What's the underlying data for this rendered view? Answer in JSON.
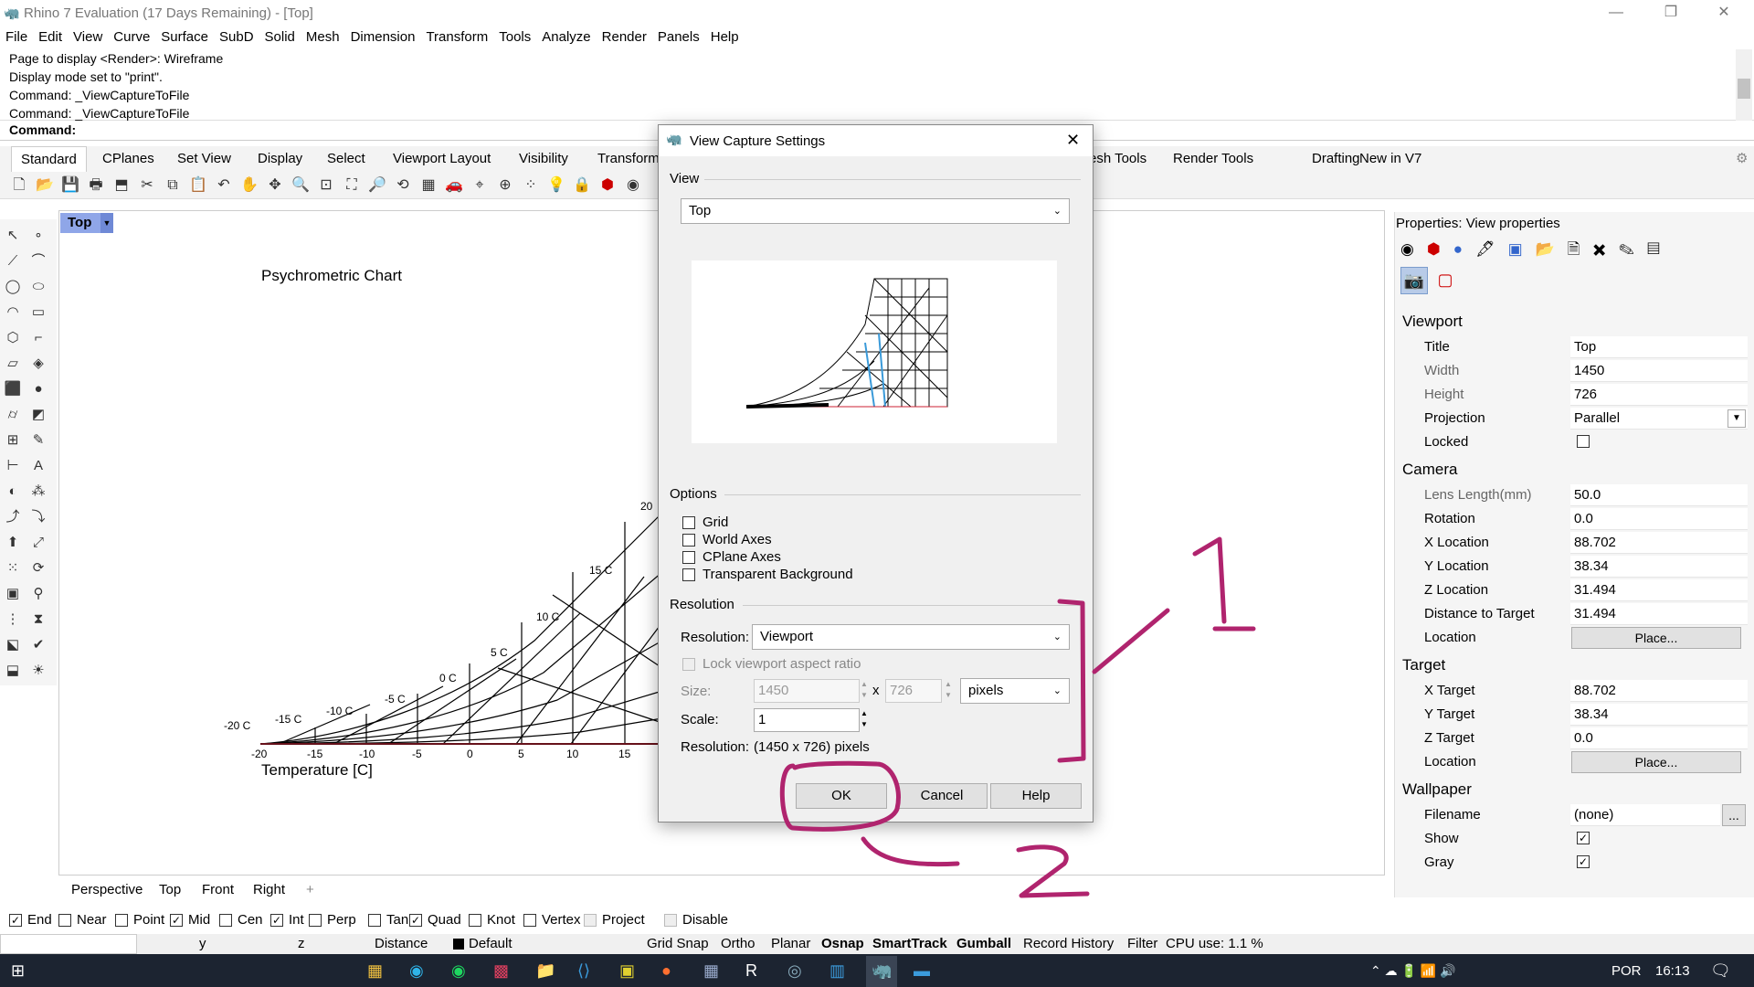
{
  "window": {
    "title": "Rhino 7 Evaluation (17 Days Remaining) - [Top]"
  },
  "menu": [
    "File",
    "Edit",
    "View",
    "Curve",
    "Surface",
    "SubD",
    "Solid",
    "Mesh",
    "Dimension",
    "Transform",
    "Tools",
    "Analyze",
    "Render",
    "Panels",
    "Help"
  ],
  "history": [
    "Page to display <Render>: Wireframe",
    "Display mode set to \"print\".",
    "Command: _ViewCaptureToFile",
    "Command: _ViewCaptureToFile"
  ],
  "command_label": "Command:",
  "toolbar_tabs": [
    "Standard",
    "CPlanes",
    "Set View",
    "Display",
    "Select",
    "Viewport Layout",
    "Visibility",
    "Transform"
  ],
  "toolbar_tabs_right": [
    "esh Tools",
    "Render Tools",
    "Drafting",
    "New in V7"
  ],
  "viewport": {
    "label": "Top",
    "chart_title": "Psychrometric Chart",
    "x_axis_label": "Temperature [C]",
    "x_ticks": [
      "-20",
      "-15",
      "-10",
      "-5",
      "0",
      "5",
      "10",
      "15"
    ],
    "curve_labels": [
      "-20 C",
      "-15 C",
      "-10 C",
      "-5 C",
      "0 C",
      "5 C",
      "10 C",
      "15 C",
      "20"
    ]
  },
  "viewport_tabs": [
    "Perspective",
    "Top",
    "Front",
    "Right"
  ],
  "osnap": [
    {
      "label": "End",
      "checked": true
    },
    {
      "label": "Near",
      "checked": false
    },
    {
      "label": "Point",
      "checked": false
    },
    {
      "label": "Mid",
      "checked": true
    },
    {
      "label": "Cen",
      "checked": false
    },
    {
      "label": "Int",
      "checked": true
    },
    {
      "label": "Perp",
      "checked": false
    },
    {
      "label": "Tan",
      "checked": false
    },
    {
      "label": "Quad",
      "checked": true
    },
    {
      "label": "Knot",
      "checked": false
    },
    {
      "label": "Vertex",
      "checked": false
    },
    {
      "label": "Project",
      "checked": false
    },
    {
      "label": "Disable",
      "checked": false
    }
  ],
  "status": {
    "y": "y",
    "z": "z",
    "distance": "Distance",
    "layer": "Default",
    "grid_snap": "Grid Snap",
    "ortho": "Ortho",
    "planar": "Planar",
    "osnap": "Osnap",
    "smarttrack": "SmartTrack",
    "gumball": "Gumball",
    "record_history": "Record History",
    "filter": "Filter",
    "cpu": "CPU use: 1.1 %"
  },
  "properties": {
    "header": "Properties: View properties",
    "viewport_section": "Viewport",
    "camera_section": "Camera",
    "target_section": "Target",
    "wallpaper_section": "Wallpaper",
    "viewport": {
      "title_label": "Title",
      "title": "Top",
      "width_label": "Width",
      "width": "1450",
      "height_label": "Height",
      "height": "726",
      "projection_label": "Projection",
      "projection": "Parallel",
      "locked_label": "Locked"
    },
    "camera": {
      "lens_label": "Lens Length(mm)",
      "lens": "50.0",
      "rotation_label": "Rotation",
      "rotation": "0.0",
      "xloc_label": "X Location",
      "xloc": "88.702",
      "yloc_label": "Y Location",
      "yloc": "38.34",
      "zloc_label": "Z Location",
      "zloc": "31.494",
      "dist_label": "Distance to Target",
      "dist": "31.494",
      "loc_label": "Location",
      "place": "Place..."
    },
    "target": {
      "x_label": "X Target",
      "x": "88.702",
      "y_label": "Y Target",
      "y": "38.34",
      "z_label": "Z Target",
      "z": "0.0",
      "loc_label": "Location",
      "place": "Place..."
    },
    "wallpaper": {
      "filename_label": "Filename",
      "filename": "(none)",
      "browse": "...",
      "show_label": "Show",
      "gray_label": "Gray"
    }
  },
  "dialog": {
    "title": "View Capture Settings",
    "view_group": "View",
    "view_value": "Top",
    "options_group": "Options",
    "options": [
      "Grid",
      "World Axes",
      "CPlane Axes",
      "Transparent Background"
    ],
    "resolution_group": "Resolution",
    "resolution_label": "Resolution:",
    "resolution_value": "Viewport",
    "lock_aspect": "Lock viewport aspect ratio",
    "size_label": "Size:",
    "size_w": "1450",
    "size_x": "x",
    "size_h": "726",
    "units": "pixels",
    "scale_label": "Scale:",
    "scale": "1",
    "resolution_summary_label": "Resolution:",
    "resolution_summary": "(1450 x 726) pixels",
    "ok": "OK",
    "cancel": "Cancel",
    "help": "Help"
  },
  "taskbar": {
    "lang": "POR",
    "time": "16:13"
  }
}
